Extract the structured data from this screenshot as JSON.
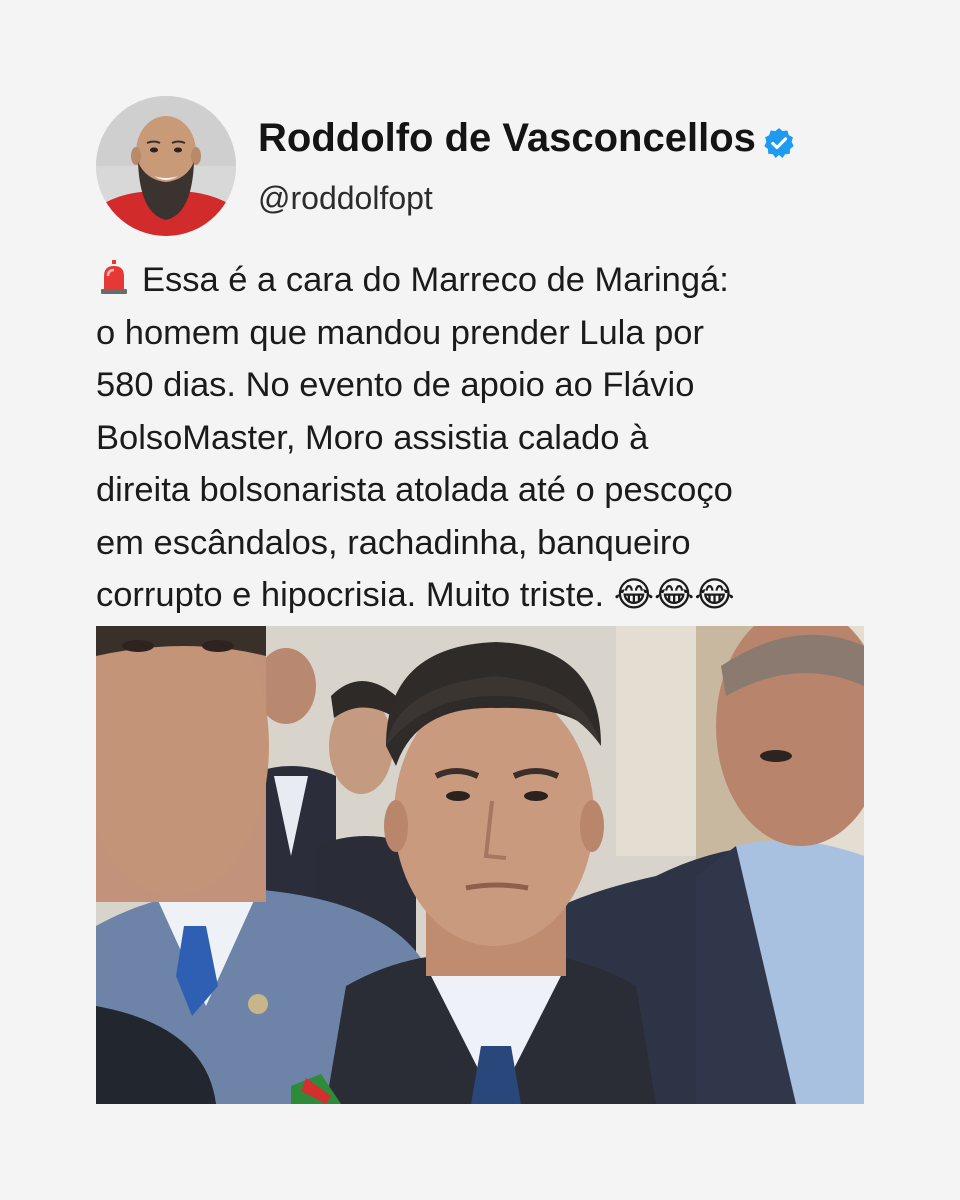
{
  "post": {
    "author": {
      "name": "Roddolfo de Vasconcellos",
      "handle": "@roddolfopt",
      "verified": true,
      "verified_color": "#1d9bf0"
    },
    "text": "Essa é a cara do Marreco de Maringá:\no homem que mandou prender Lula por\n580 dias. No evento de apoio ao Flávio\nBolsoMaster, Moro assistia calado à\ndireita bolsonarista atolada até o pescoço\nem escândalos, rachadinha, banqueiro\ncorrupto e hipocrisia. Muito triste. 😂😂😂",
    "leading_emoji": "siren-icon",
    "media": {
      "type": "photo",
      "description_icon": "photo-image"
    }
  },
  "colors": {
    "background": "#f4f4f4",
    "text": "#1b1b1b",
    "verified": "#1d9bf0"
  }
}
